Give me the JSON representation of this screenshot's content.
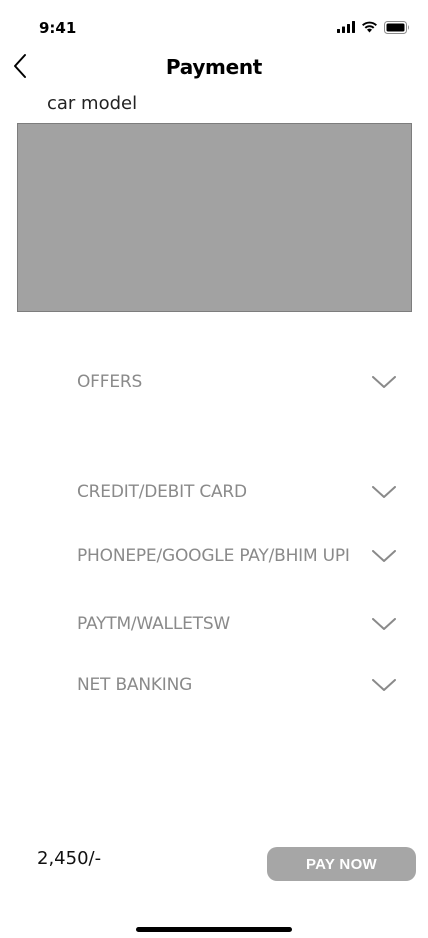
{
  "status_bar": {
    "time": "9:41"
  },
  "header": {
    "title": "Payment"
  },
  "car": {
    "model_label": "car model"
  },
  "payment_options": [
    {
      "label": "OFFERS"
    },
    {
      "label": "CREDIT/DEBIT CARD"
    },
    {
      "label": "PHONEPE/GOOGLE PAY/BHIM UPI"
    },
    {
      "label": "PAYTM/WALLETSW"
    },
    {
      "label": "NET BANKING"
    }
  ],
  "footer": {
    "price": "2,450/-",
    "pay_button_label": "PAY NOW"
  },
  "colors": {
    "image_placeholder": "#a2a2a2",
    "option_text": "#8a8a8a",
    "pay_button_bg": "#a6a6a6"
  }
}
